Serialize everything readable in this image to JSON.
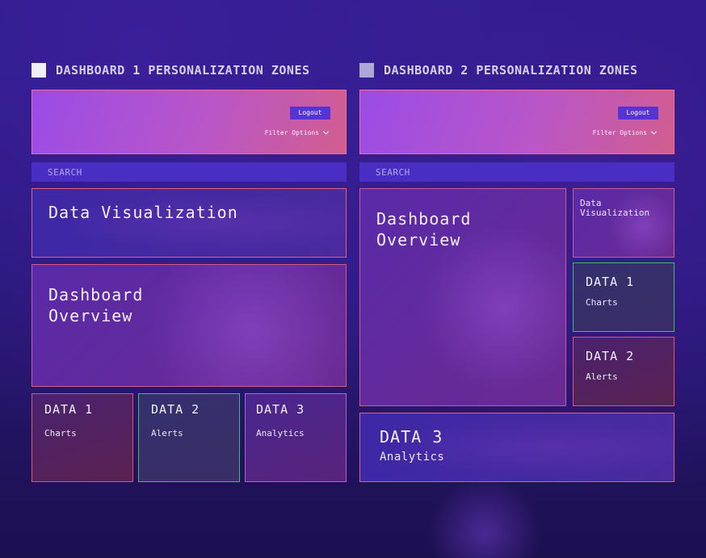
{
  "dashboard1": {
    "heading": "DASHBOARD 1 PERSONALIZATION ZONES",
    "logout_label": "Logout",
    "filter_label": "Filter Options",
    "search_placeholder": "SEARCH",
    "data_viz_title": "Data Visualization",
    "overview_title_line1": "Dashboard",
    "overview_title_line2": "Overview",
    "cards": [
      {
        "title": "DATA 1",
        "subtitle": "Charts"
      },
      {
        "title": "DATA 2",
        "subtitle": "Alerts"
      },
      {
        "title": "DATA 3",
        "subtitle": "Analytics"
      }
    ]
  },
  "dashboard2": {
    "heading": "DASHBOARD 2 PERSONALIZATION ZONES",
    "logout_label": "Logout",
    "filter_label": "Filter Options",
    "search_placeholder": "SEARCH",
    "overview_title_line1": "Dashboard",
    "overview_title_line2": "Overview",
    "data_viz_line1": "Data",
    "data_viz_line2": "Visualization",
    "cards": [
      {
        "title": "DATA 1",
        "subtitle": "Charts"
      },
      {
        "title": "DATA 2",
        "subtitle": "Alerts"
      },
      {
        "title": "DATA 3",
        "subtitle": "Analytics"
      }
    ]
  },
  "colors": {
    "heading_square_1": "#f0eef8",
    "heading_square_2": "#b0a6d8",
    "header_border": "#ff6b8a",
    "button_bg": "#5434d4",
    "search_bg": "#4a2ec4"
  },
  "icons": {
    "filter_chevron": "chevron-down-icon"
  }
}
